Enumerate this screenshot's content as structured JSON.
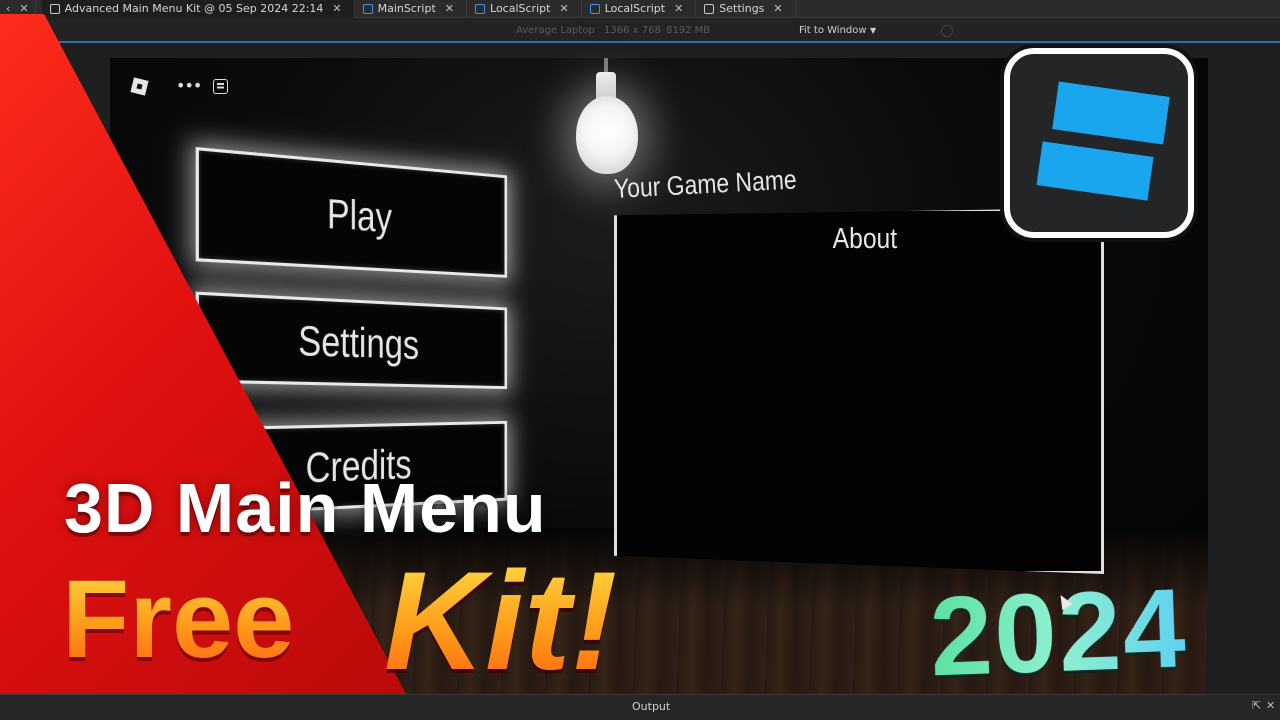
{
  "tabs": [
    {
      "label": "Advanced Main Menu Kit @ 05 Sep 2024 22:14",
      "icon": "place-file-icon"
    },
    {
      "label": "MainScript",
      "icon": "script-icon"
    },
    {
      "label": "LocalScript",
      "icon": "script-icon"
    },
    {
      "label": "LocalScript",
      "icon": "script-icon"
    },
    {
      "label": "Settings",
      "icon": "document-icon"
    }
  ],
  "viewbar": {
    "device": "Average Laptop",
    "resolution": "1366 x 768",
    "memory": "8192 MB",
    "fit": "Fit to Window"
  },
  "game": {
    "buttons": {
      "play": "Play",
      "settings": "Settings",
      "credits": "Credits"
    },
    "game_name": "Your Game Name",
    "about_title": "About"
  },
  "overlay": {
    "headline": "3D Main Menu",
    "free": "Free",
    "kit": "Kit!",
    "year": "2024"
  },
  "output": {
    "label": "Output"
  },
  "colors": {
    "banner_red": "#e01010",
    "studio_blue": "#19a6ee",
    "accent_blue": "#2d6cb3"
  }
}
